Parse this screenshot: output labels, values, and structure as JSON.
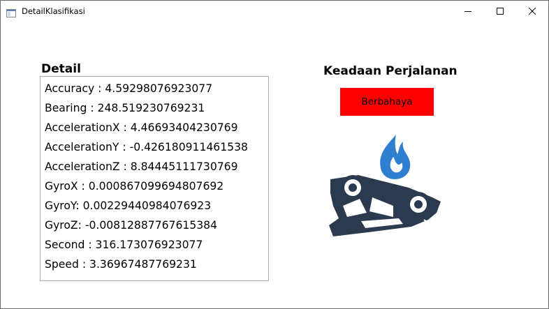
{
  "window": {
    "title": "DetailKlasifikasi",
    "controls": {
      "minimize": "minimize-icon",
      "maximize": "maximize-icon",
      "close": "close-icon"
    }
  },
  "detail": {
    "heading": "Detail",
    "lines": [
      "Accuracy : 4.59298076923077",
      "Bearing : 248.519230769231",
      "AccelerationX : 4.46693404230769",
      "AccelerationY : -0.426180911461538",
      "AccelerationZ : 8.84445111730769",
      "GyroX : 0.000867099694807692",
      "GyroY: 0.00229440984076923",
      "GyroZ: -0.00812887767615384",
      "Second : 316.173076923077",
      "Speed : 3.36967487769231"
    ]
  },
  "status": {
    "heading": "Keadaan Perjalanan",
    "badge_label": "Berbahaya",
    "badge_color": "#ff0000",
    "illustration": "overturned-burning-car-icon",
    "flame_color": "#2f7fd0",
    "car_color": "#2b3a4e"
  }
}
